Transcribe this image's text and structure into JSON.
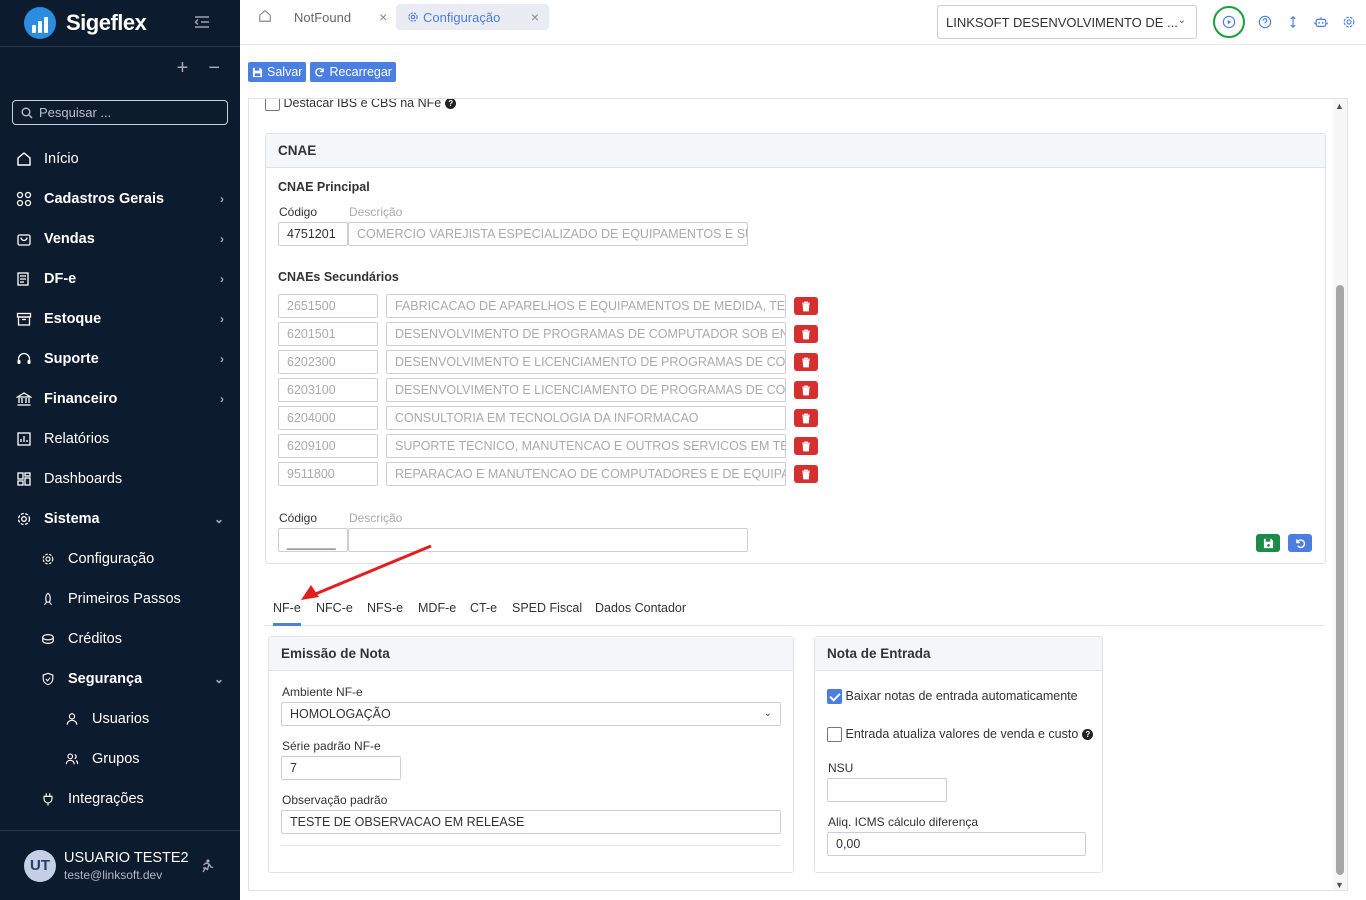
{
  "app": {
    "name": "Sigeflex",
    "accent": "#4a7ee0",
    "sidebar_bg": "#0d1b2e"
  },
  "sidebar": {
    "search_placeholder": "Pesquisar ...",
    "items": [
      {
        "label": "Início",
        "icon": "home-icon",
        "bold": false
      },
      {
        "label": "Cadastros Gerais",
        "icon": "grid-icon",
        "bold": true
      },
      {
        "label": "Vendas",
        "icon": "bag-icon",
        "bold": true
      },
      {
        "label": "DF-e",
        "icon": "document-icon",
        "bold": true
      },
      {
        "label": "Estoque",
        "icon": "box-icon",
        "bold": true
      },
      {
        "label": "Suporte",
        "icon": "headset-icon",
        "bold": true
      },
      {
        "label": "Financeiro",
        "icon": "bank-icon",
        "bold": true
      },
      {
        "label": "Relatórios",
        "icon": "report-icon",
        "bold": false
      },
      {
        "label": "Dashboards",
        "icon": "dashboard-icon",
        "bold": false
      },
      {
        "label": "Sistema",
        "icon": "gear-icon",
        "bold": true
      },
      {
        "label": "Configuração",
        "icon": "gear-icon",
        "bold": false
      },
      {
        "label": "Primeiros Passos",
        "icon": "rocket-icon",
        "bold": false
      },
      {
        "label": "Créditos",
        "icon": "coins-icon",
        "bold": false
      },
      {
        "label": "Segurança",
        "icon": "shield-icon",
        "bold": true
      },
      {
        "label": "Usuarios",
        "icon": "user-icon",
        "bold": false
      },
      {
        "label": "Grupos",
        "icon": "users-icon",
        "bold": false
      },
      {
        "label": "Integrações",
        "icon": "plug-icon",
        "bold": false
      }
    ],
    "user": {
      "initials": "UT",
      "name": "USUARIO TESTE2",
      "email": "teste@linksoft.dev"
    }
  },
  "topbar": {
    "tabs": [
      {
        "label": "NotFound"
      },
      {
        "label": "Configuração"
      }
    ],
    "company": "LINKSOFT DESENVOLVIMENTO DE ..."
  },
  "actions": {
    "save": "Salvar",
    "reload": "Recarregar"
  },
  "destacar_label": "Destacar IBS e CBS na NFe",
  "cnae": {
    "title": "CNAE",
    "principal_title": "CNAE Principal",
    "codigo_label": "Código",
    "descricao_label": "Descrição",
    "principal": {
      "codigo": "4751201",
      "descricao": "COMERCIO VAREJISTA ESPECIALIZADO DE EQUIPAMENTOS E SU"
    },
    "secundarios_title": "CNAEs Secundários",
    "secundarios": [
      {
        "codigo": "2651500",
        "descricao": "FABRICACAO DE APARELHOS E EQUIPAMENTOS DE MEDIDA, TES"
      },
      {
        "codigo": "6201501",
        "descricao": "DESENVOLVIMENTO DE PROGRAMAS DE COMPUTADOR SOB ENC"
      },
      {
        "codigo": "6202300",
        "descricao": "DESENVOLVIMENTO E LICENCIAMENTO DE PROGRAMAS DE COM"
      },
      {
        "codigo": "6203100",
        "descricao": "DESENVOLVIMENTO E LICENCIAMENTO DE PROGRAMAS DE COM"
      },
      {
        "codigo": "6204000",
        "descricao": "CONSULTORIA EM TECNOLOGIA DA INFORMACAO"
      },
      {
        "codigo": "6209100",
        "descricao": "SUPORTE TECNICO, MANUTENCAO E OUTROS SERVICOS EM TEC"
      },
      {
        "codigo": "9511800",
        "descricao": "REPARACAO E MANUTENCAO DE COMPUTADORES E DE EQUIPAM"
      }
    ],
    "new_codigo_mask": "_______"
  },
  "doc_tabs": [
    "NF-e",
    "NFC-e",
    "NFS-e",
    "MDF-e",
    "CT-e",
    "SPED Fiscal",
    "Dados Contador"
  ],
  "emissao": {
    "title": "Emissão de Nota",
    "ambiente_label": "Ambiente NF-e",
    "ambiente_value": "HOMOLOGAÇÃO",
    "serie_label": "Série padrão NF-e",
    "serie_value": "7",
    "obs_label": "Observação padrão",
    "obs_value": "TESTE DE OBSERVACAO EM RELEASE"
  },
  "entrada": {
    "title": "Nota de Entrada",
    "baixar_label": "Baixar notas de entrada automaticamente",
    "baixar_checked": true,
    "atualiza_label": "Entrada atualiza valores de venda e custo",
    "atualiza_checked": false,
    "nsu_label": "NSU",
    "nsu_value": "",
    "aliq_label": "Aliq. ICMS cálculo diferença",
    "aliq_value": "0,00"
  }
}
